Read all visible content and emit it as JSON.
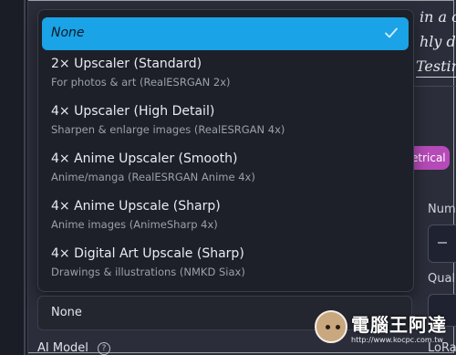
{
  "background": {
    "text_lines": [
      "in a c",
      "hly de",
      "Testin"
    ],
    "chip": "etrical",
    "labels": {
      "num": "Num",
      "qual": "Qual",
      "lora": "LoRa"
    }
  },
  "dropdown": {
    "selected": "None",
    "options": [
      {
        "title": "2× Upscaler (Standard)",
        "subtitle": "For photos & art (RealESRGAN 2x)"
      },
      {
        "title": "4× Upscaler (High Detail)",
        "subtitle": "Sharpen & enlarge images (RealESRGAN 4x)"
      },
      {
        "title": "4× Anime Upscaler (Smooth)",
        "subtitle": "Anime/manga (RealESRGAN Anime 4x)"
      },
      {
        "title": "4× Anime Upscale (Sharp)",
        "subtitle": "Anime images (AnimeSharp 4x)"
      },
      {
        "title": "4× Digital Art Upscale (Sharp)",
        "subtitle": "Drawings & illustrations (NMKD Siax)"
      }
    ]
  },
  "select_field": {
    "value": "None"
  },
  "ai_model": {
    "label": "AI Model"
  },
  "colors": {
    "accent": "#1aa3e6",
    "chip": "#b64ab8",
    "panel": "#1d2029"
  },
  "watermark": {
    "brand": "電腦王阿達",
    "url": "http://www.kocpc.com.tw"
  }
}
